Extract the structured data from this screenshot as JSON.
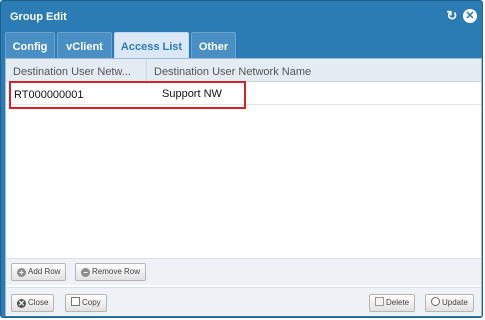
{
  "window": {
    "title": "Group Edit",
    "refresh_icon": "refresh-icon",
    "close_icon": "close-icon",
    "refresh_glyph": "↻",
    "close_glyph": "✕"
  },
  "tabs": [
    {
      "label": "Config",
      "active": false
    },
    {
      "label": "vClient",
      "active": false
    },
    {
      "label": "Access List",
      "active": true
    },
    {
      "label": "Other",
      "active": false
    }
  ],
  "grid": {
    "columns": [
      "Destination User Netw...",
      "Destination User Network Name"
    ],
    "rows": [
      [
        "RT000000001",
        "Support NW"
      ]
    ]
  },
  "grid_toolbar": {
    "add_row_label": "Add Row",
    "remove_row_label": "Remove Row",
    "add_glyph": "+",
    "remove_glyph": "−"
  },
  "footer": {
    "close_label": "Close",
    "copy_label": "Copy",
    "delete_label": "Delete",
    "update_label": "Update",
    "close_glyph": "✕"
  },
  "colors": {
    "window_blue": "#2b7bb5",
    "highlight_red": "#d8212b"
  }
}
